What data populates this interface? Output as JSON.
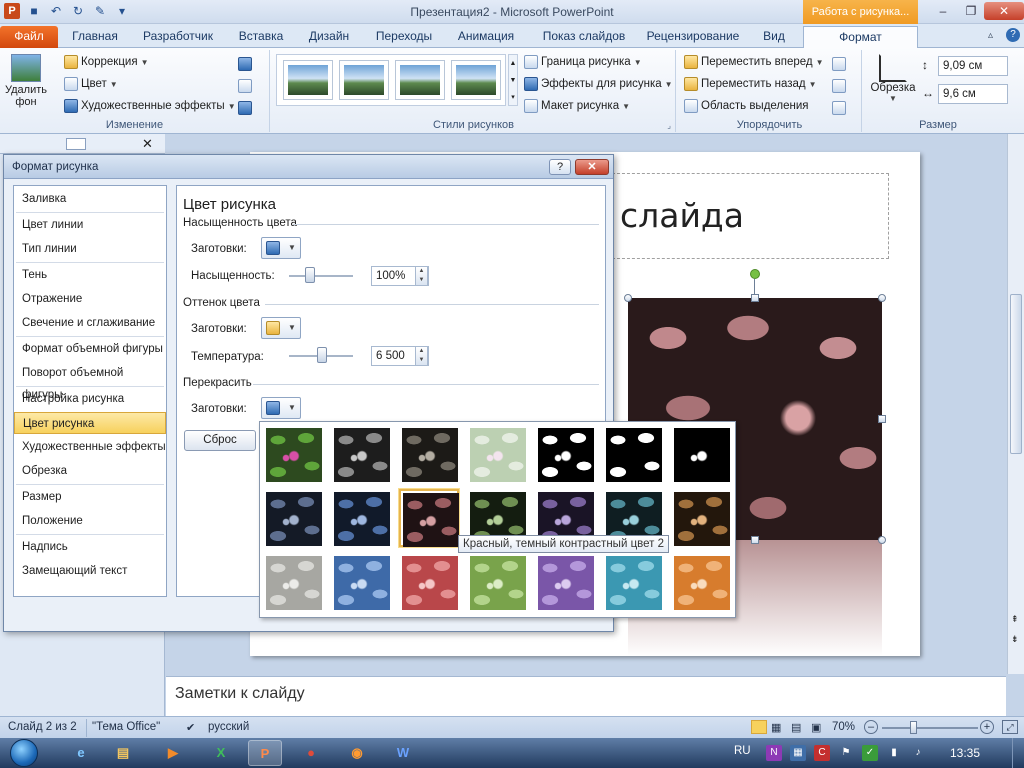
{
  "window": {
    "title": "Презентация2 - Microsoft PowerPoint",
    "context_tab": "Работа с рисунка...",
    "minimize": "–",
    "maximize": "❐",
    "close": "✕"
  },
  "tabs": [
    {
      "label": "Файл"
    },
    {
      "label": "Главная"
    },
    {
      "label": "Разработчик"
    },
    {
      "label": "Вставка"
    },
    {
      "label": "Дизайн"
    },
    {
      "label": "Переходы"
    },
    {
      "label": "Анимация"
    },
    {
      "label": "Показ слайдов"
    },
    {
      "label": "Рецензирование"
    },
    {
      "label": "Вид"
    },
    {
      "label": "Формат"
    }
  ],
  "ribbon": {
    "izmenenie": {
      "label": "Изменение",
      "remove_bg": "Удалить фон",
      "correction": "Коррекция",
      "color": "Цвет",
      "art_effects": "Художественные эффекты"
    },
    "styles": {
      "label": "Стили рисунков",
      "border": "Граница рисунка",
      "effects": "Эффекты для рисунка",
      "layout": "Макет рисунка"
    },
    "arrange": {
      "label": "Упорядочить",
      "forward": "Переместить вперед",
      "backward": "Переместить назад",
      "selection": "Область выделения"
    },
    "size": {
      "label": "Размер",
      "crop": "Обрезка",
      "height": "9,09 см",
      "width": "9,6 см"
    }
  },
  "slide": {
    "title": "слайда",
    "notes": "Заметки к слайду"
  },
  "dialog": {
    "title": "Формат рисунка",
    "help": "?",
    "close": "✕",
    "nav": [
      {
        "label": "Заливка"
      },
      {
        "label": "Цвет линии"
      },
      {
        "label": "Тип линии"
      },
      {
        "label": "Тень"
      },
      {
        "label": "Отражение"
      },
      {
        "label": "Свечение и сглаживание"
      },
      {
        "label": "Формат объемной фигуры"
      },
      {
        "label": "Поворот объемной фигуры"
      },
      {
        "label": "Настройка рисунка"
      },
      {
        "label": "Цвет рисунка"
      },
      {
        "label": "Художественные эффекты"
      },
      {
        "label": "Обрезка"
      },
      {
        "label": "Размер"
      },
      {
        "label": "Положение"
      },
      {
        "label": "Надпись"
      },
      {
        "label": "Замещающий текст"
      }
    ],
    "selected_nav": "Цвет рисунка",
    "panel": {
      "heading": "Цвет рисунка",
      "saturation_section": "Насыщенность цвета",
      "presets_label": "Заготовки:",
      "saturation_label": "Насыщенность:",
      "saturation_value": "100%",
      "tone_section": "Оттенок цвета",
      "temperature_label": "Температура:",
      "temperature_value": "6 500",
      "recolor_section": "Перекрасить",
      "reset": "Сброс"
    },
    "gallery": {
      "tooltip": "Красный, темный контрастный цвет 2",
      "hover_row": 1,
      "hover_col": 2,
      "rows": [
        [
          {
            "bg": "#2d4a1f",
            "fg": "#5fa53a",
            "accent": "#d84fa7"
          },
          {
            "bg": "#1d1d1d",
            "fg": "#8a8a8a",
            "accent": "#c8c8c8"
          },
          {
            "bg": "#1c1a17",
            "fg": "#6f6a61",
            "accent": "#b3ada2"
          },
          {
            "bg": "#bcd0b2",
            "fg": "#e4ecdf",
            "accent": "#f3e4ee"
          },
          {
            "bg": "#000000",
            "fg": "#ffffff",
            "accent": "#ffffff"
          },
          {
            "bg": "#000000",
            "fg": "#ffffff",
            "accent": "#000000"
          },
          {
            "bg": "#000000",
            "fg": "#000000",
            "accent": "#ffffff"
          }
        ],
        [
          {
            "bg": "#141a26",
            "fg": "#5d6e8f",
            "accent": "#a2b1cc"
          },
          {
            "bg": "#111a2a",
            "fg": "#4d6fa6",
            "accent": "#9db6df"
          },
          {
            "bg": "#1f1214",
            "fg": "#9a5d61",
            "accent": "#d59fa2"
          },
          {
            "bg": "#141d10",
            "fg": "#6f8f52",
            "accent": "#b3cf98"
          },
          {
            "bg": "#1a1426",
            "fg": "#78619e",
            "accent": "#b8a5da"
          },
          {
            "bg": "#0f1e22",
            "fg": "#4d8c9a",
            "accent": "#98cfdb"
          },
          {
            "bg": "#23170c",
            "fg": "#a0703c",
            "accent": "#e2b27e"
          }
        ],
        [
          {
            "bg": "#a7a7a2",
            "fg": "#d6d6d2",
            "accent": "#ecece9"
          },
          {
            "bg": "#3e6aa8",
            "fg": "#8fb1e0",
            "accent": "#c9dbf3"
          },
          {
            "bg": "#b9474a",
            "fg": "#e38f90",
            "accent": "#f5c7c7"
          },
          {
            "bg": "#79a34b",
            "fg": "#b3d48b",
            "accent": "#dcedc6"
          },
          {
            "bg": "#7a56a8",
            "fg": "#b497da",
            "accent": "#dccbf0"
          },
          {
            "bg": "#3b98b2",
            "fg": "#86cbdd",
            "accent": "#c7e9f1"
          },
          {
            "bg": "#d77c2d",
            "fg": "#f0b278",
            "accent": "#f9dcbd"
          }
        ]
      ]
    }
  },
  "status": {
    "slide": "Слайд 2 из 2",
    "theme": "\"Тема Office\"",
    "language": "русский",
    "zoom": "70%"
  },
  "taskbar": {
    "lang": "RU",
    "time": "13:35"
  },
  "colors": {
    "file_tab": "#d2480e",
    "context_tab": "#f09a23",
    "selection": "#f7d15d"
  }
}
